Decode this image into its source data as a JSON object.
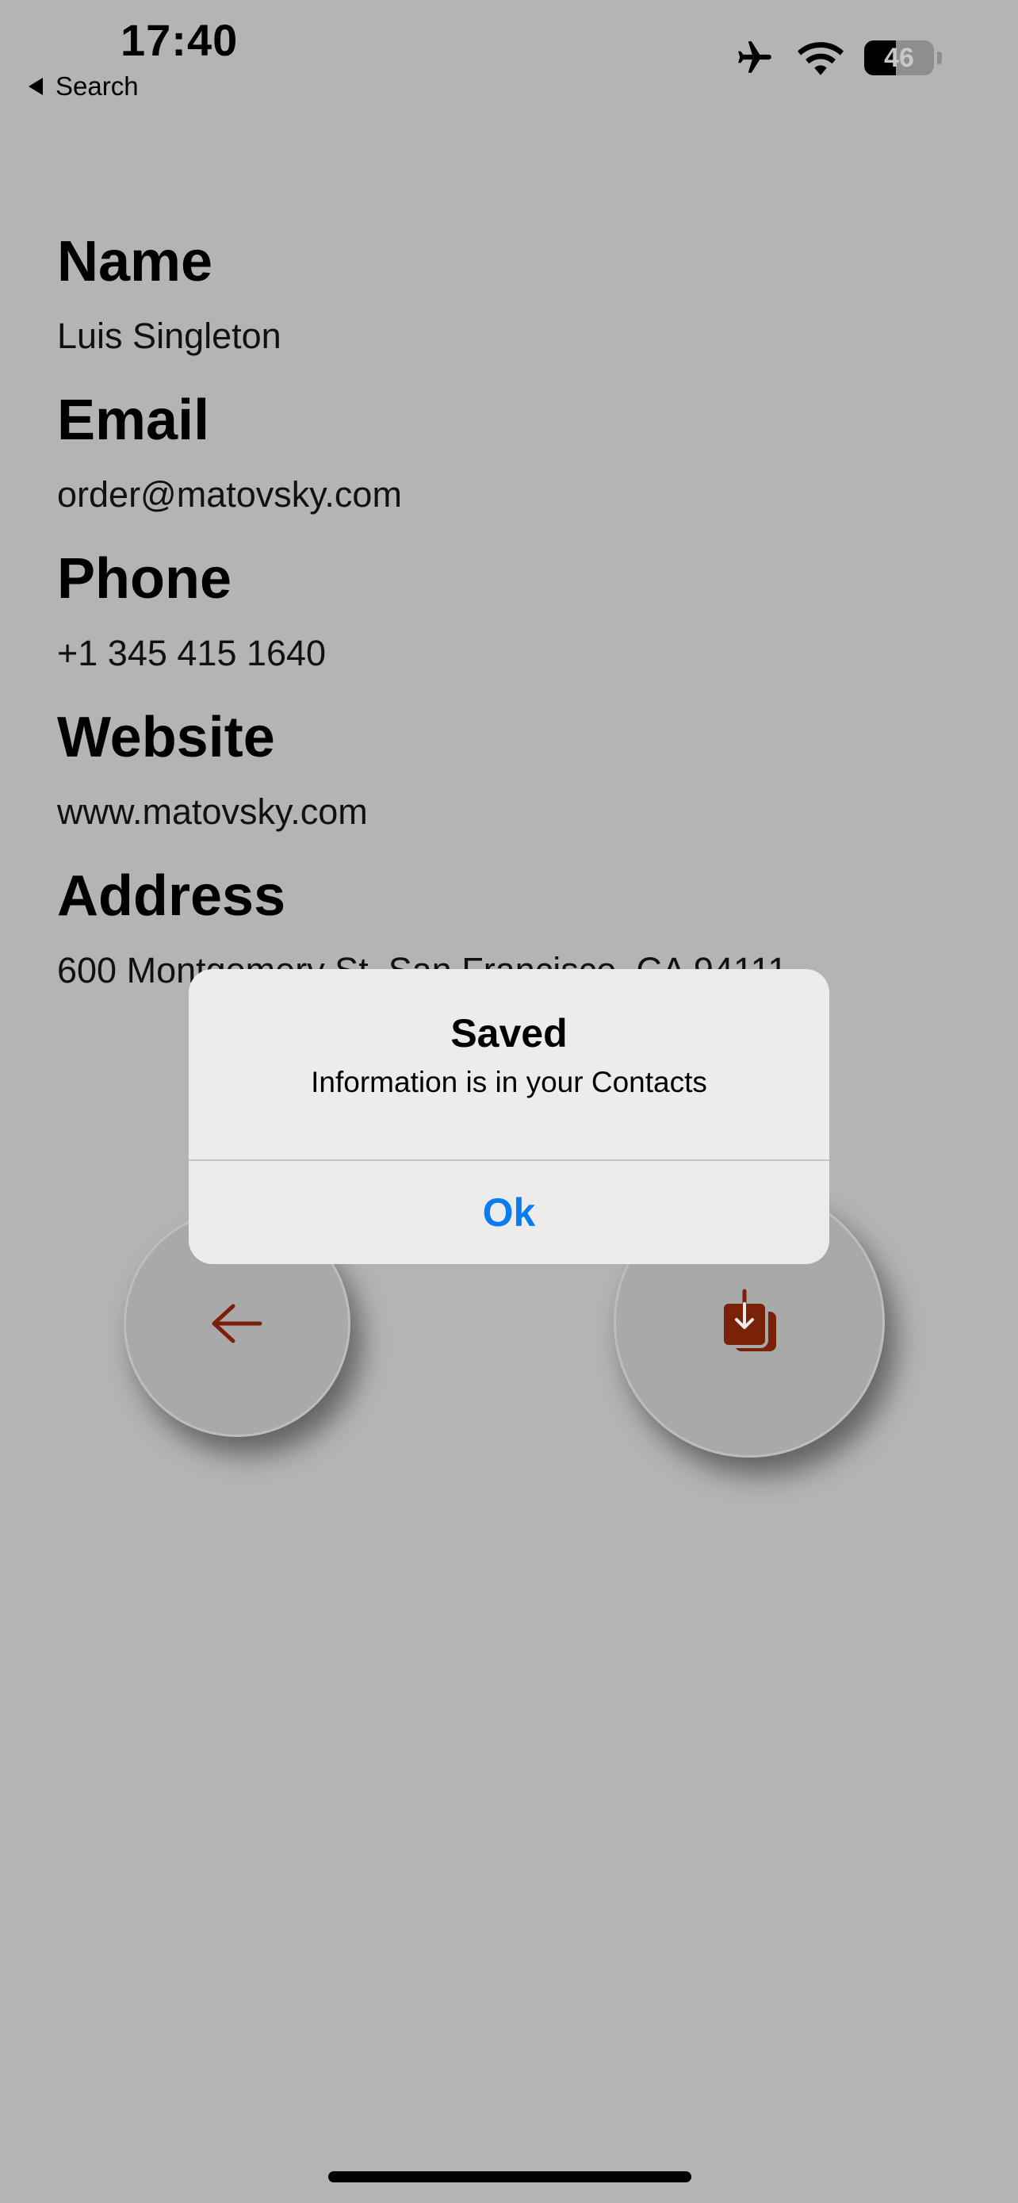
{
  "status_bar": {
    "time": "17:40",
    "back_label": "Search",
    "battery_level": "46",
    "icons": [
      "airplane-icon",
      "wifi-icon",
      "battery-icon"
    ]
  },
  "contact": {
    "name_label": "Name",
    "name_value": "Luis Singleton",
    "email_label": "Email",
    "email_value": "order@matovsky.com",
    "phone_label": "Phone",
    "phone_value": "+1 345 415 1640",
    "website_label": "Website",
    "website_value": "www.matovsky.com",
    "address_label": "Address",
    "address_value": "600 Montgomery St, San Francisco, CA 94111"
  },
  "buttons": {
    "back_icon": "arrow-left-icon",
    "save_icon": "save-to-contacts-icon",
    "icon_color": "#7a2208"
  },
  "alert": {
    "title": "Saved",
    "message": "Information is in your Contacts",
    "ok_label": "Ok",
    "ok_color": "#0a7cf0"
  }
}
